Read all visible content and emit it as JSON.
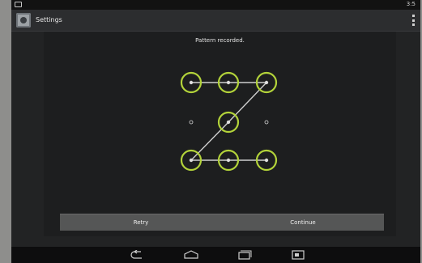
{
  "window": {
    "title": "Settings"
  },
  "status_bar": {
    "time": "3:5"
  },
  "pattern": {
    "header": "Pattern recorded.",
    "accent_color": "#b3d33a",
    "line_color": "#cfcfcf",
    "grid_selected": [
      [
        true,
        true,
        true
      ],
      [
        false,
        true,
        false
      ],
      [
        true,
        true,
        true
      ]
    ]
  },
  "buttons": {
    "retry_label": "Retry",
    "continue_label": "Continue"
  },
  "nav": {
    "icons": [
      "back-icon",
      "home-icon",
      "recent-apps-icon",
      "screenshot-icon"
    ]
  }
}
